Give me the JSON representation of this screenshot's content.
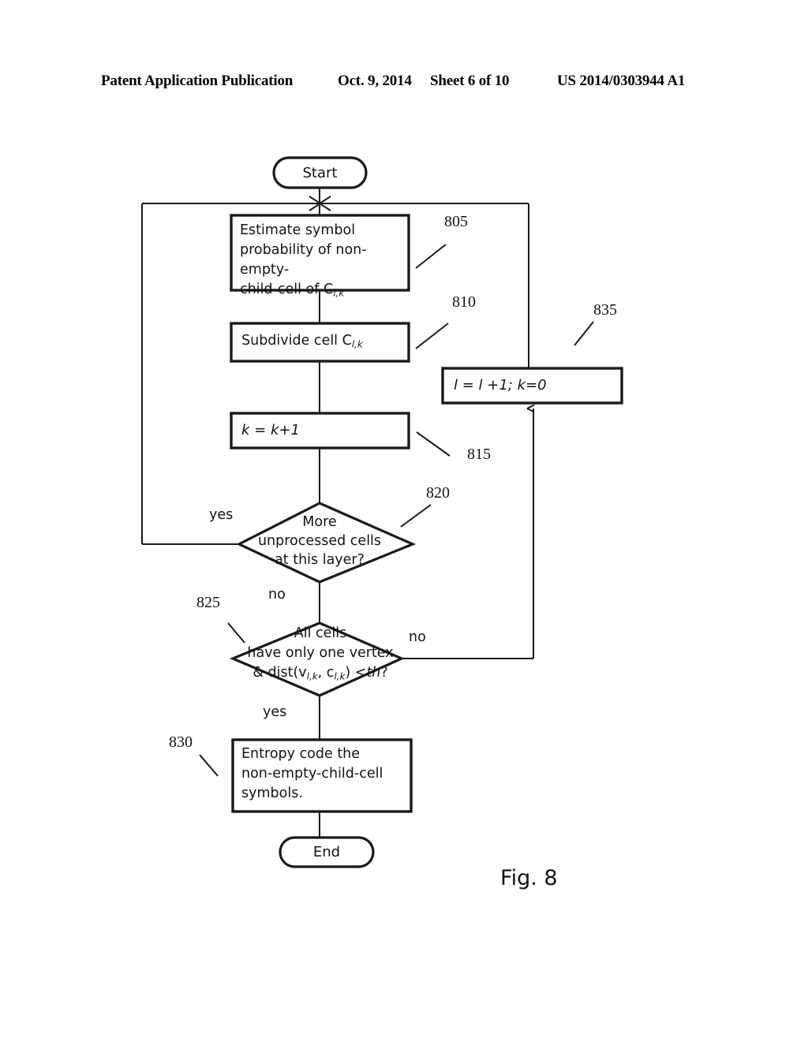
{
  "header": {
    "publication": "Patent Application Publication",
    "date": "Oct. 9, 2014",
    "sheet": "Sheet 6 of 10",
    "patent_number": "US 2014/0303944 A1"
  },
  "figure": {
    "caption": "Fig. 8",
    "nodes": {
      "start": {
        "label": "Start",
        "shape": "terminator"
      },
      "estimate": {
        "label": "Estimate  symbol\nprobability of non-empty-\nchild-cell  of C",
        "subscript": "l,k",
        "ref": "805",
        "shape": "process"
      },
      "subdivide": {
        "label": "Subdivide cell C",
        "subscript": "l,k",
        "ref": "810",
        "shape": "process"
      },
      "increment_k": {
        "label": "k = k+1",
        "ref": "815",
        "shape": "process"
      },
      "increment_l": {
        "label": "l = l +1; k=0",
        "ref": "835",
        "shape": "process"
      },
      "more_cells": {
        "label": "More\nunprocessed cells\nat this layer?",
        "ref": "820",
        "shape": "decision"
      },
      "all_cells": {
        "line1": "All cells",
        "line2": "have only one vertex",
        "line3_a": "& dist(v",
        "line3_sub1": "l,k",
        "line3_b": ", c",
        "line3_sub2": "l,k",
        "line3_c": ") <",
        "line3_th": "th",
        "line3_d": "?",
        "ref": "825",
        "shape": "decision"
      },
      "entropy": {
        "label": "Entropy code the\nnon-empty-child-cell\nsymbols.",
        "ref": "830",
        "shape": "process"
      },
      "end": {
        "label": "End",
        "shape": "terminator"
      }
    },
    "branch_labels": {
      "more_cells_yes": "yes",
      "more_cells_no": "no",
      "all_cells_yes": "yes",
      "all_cells_no": "no"
    },
    "colors": {
      "stroke": "#1a1a1a",
      "text": "#141414",
      "background": "#ffffff"
    }
  }
}
